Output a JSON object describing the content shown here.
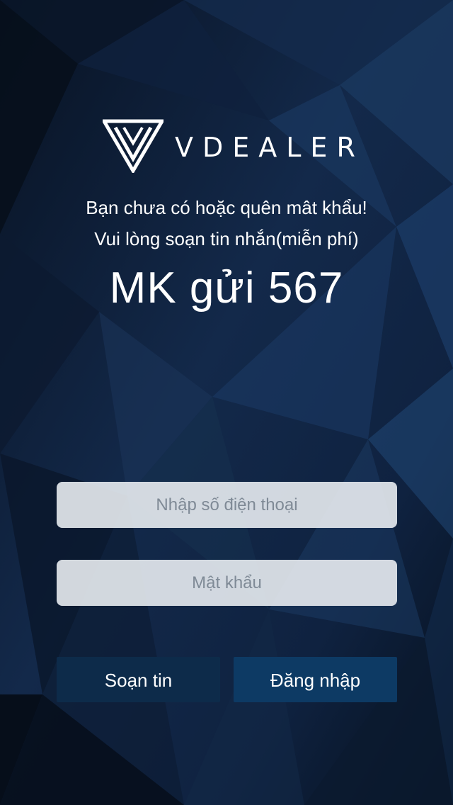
{
  "brand": {
    "name": "VDEALER",
    "logo_icon": "vdealer-v-icon"
  },
  "message": {
    "line1": "Bạn chưa có hoặc quên mât khẩu!",
    "line2": "Vui lòng soạn tin nhắn(miễn phí)",
    "code": "MK gửi 567"
  },
  "form": {
    "phone_placeholder": "Nhập số điện thoại",
    "phone_value": "",
    "password_placeholder": "Mật khẩu",
    "password_value": ""
  },
  "buttons": {
    "sms_label": "Soạn tin",
    "login_label": "Đăng nhập"
  },
  "colors": {
    "background": "#0b1526",
    "button_sms": "#0d2b4a",
    "button_login": "#0d3a64",
    "field_bg": "#e8ecf1"
  }
}
